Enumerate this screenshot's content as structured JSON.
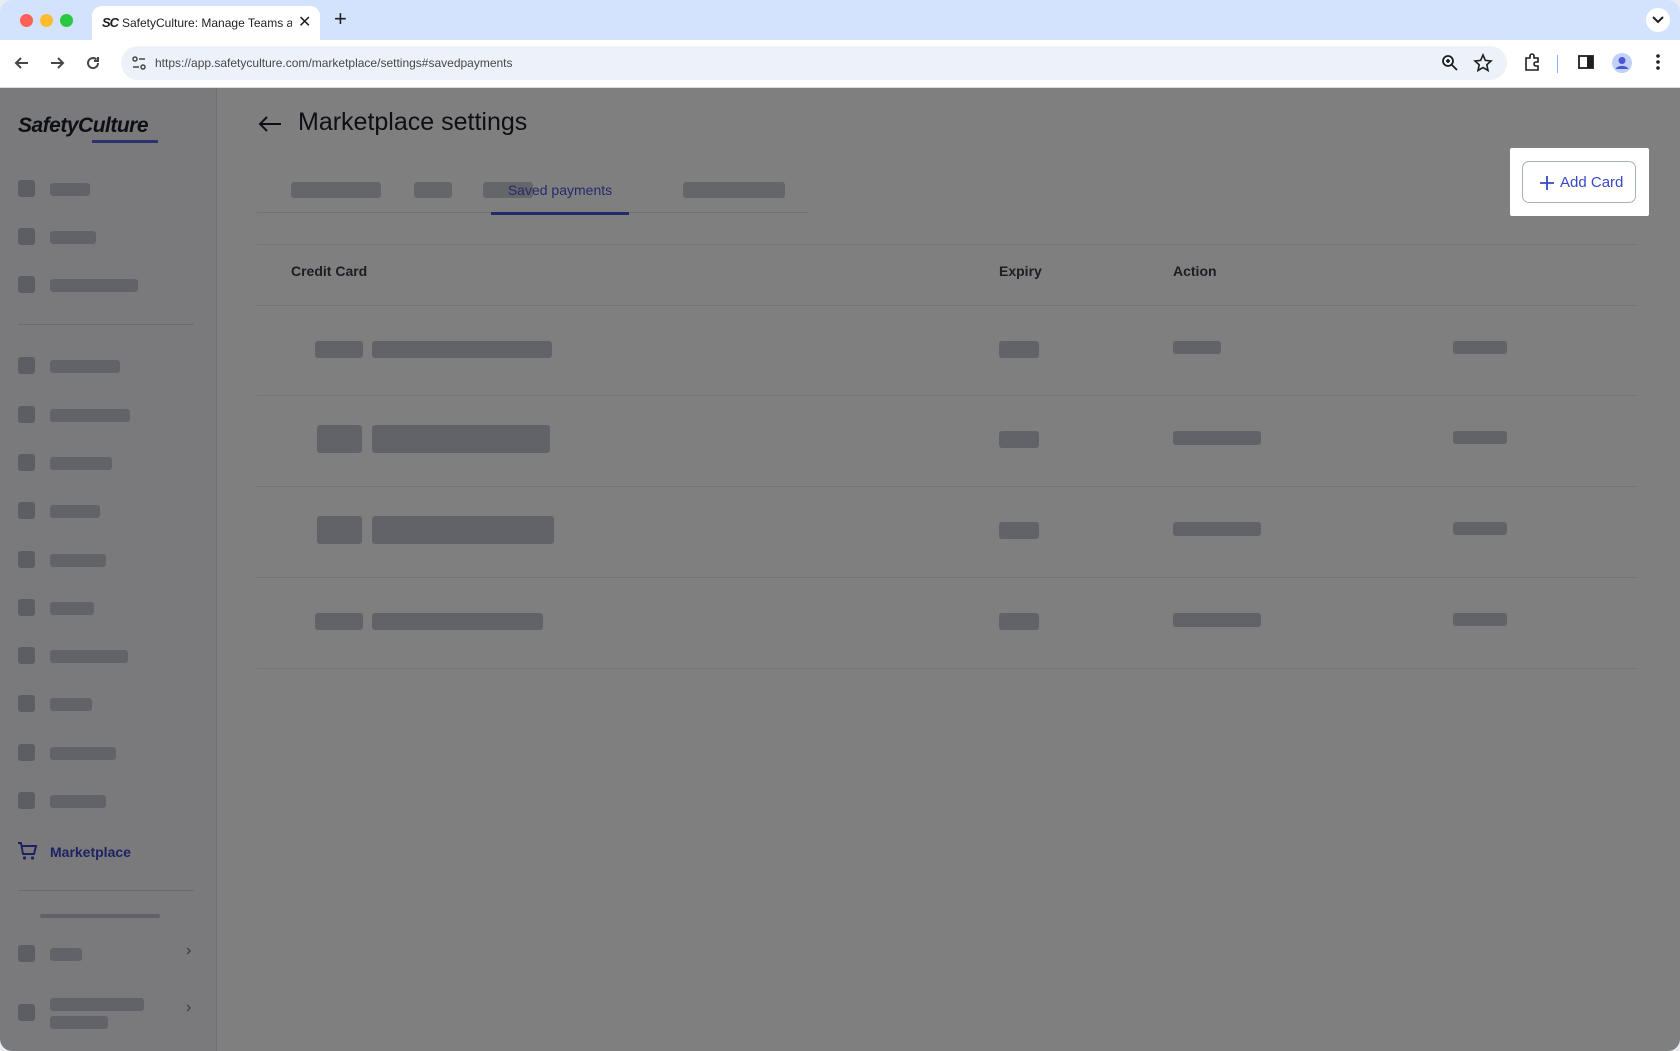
{
  "browser": {
    "tab_title": "SafetyCulture: Manage Teams and...",
    "tab_favicon": "SC",
    "url": "https://app.safetyculture.com/marketplace/settings#savedpayments",
    "icons": [
      "back-icon",
      "forward-icon",
      "reload-icon",
      "site-settings-icon",
      "zoom-icon",
      "bookmark-star-icon",
      "extensions-icon",
      "side-panel-icon",
      "profile-icon",
      "menu-icon"
    ]
  },
  "sidebar": {
    "logo": "SafetyCulture",
    "active_item": "Marketplace"
  },
  "page": {
    "title": "Marketplace settings",
    "active_tab": "Saved payments",
    "add_card_label": "Add Card"
  },
  "table": {
    "headers": {
      "credit_card": "Credit Card",
      "expiry": "Expiry",
      "action": "Action"
    },
    "row_count": 4
  },
  "colors": {
    "accent": "#4a55d6",
    "overlay": "rgba(0,0,0,0.50)",
    "tabstrip": "#d3e3fd"
  }
}
